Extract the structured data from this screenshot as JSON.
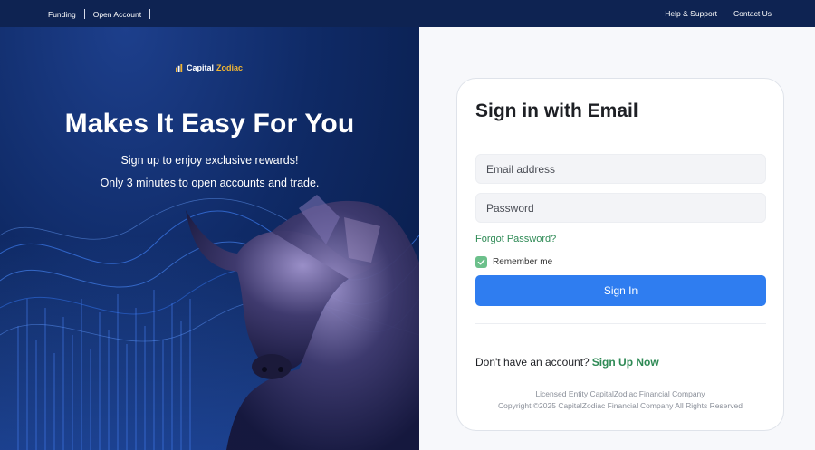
{
  "topbar": {
    "left_links": [
      "Funding",
      "Open Account"
    ],
    "right_links": [
      "Help & Support",
      "Contact Us"
    ]
  },
  "logo": {
    "part1": "Capital",
    "part2": "Zodiac"
  },
  "hero": {
    "title": "Makes It Easy For You",
    "subtitle1": "Sign up to enjoy exclusive rewards!",
    "subtitle2": "Only 3 minutes to open accounts and trade."
  },
  "signin": {
    "title": "Sign in with Email",
    "email_placeholder": "Email address",
    "password_placeholder": "Password",
    "forgot": "Forgot Password?",
    "remember": "Remember me",
    "button": "Sign In",
    "no_account": "Don't have an account?",
    "signup": "Sign Up Now",
    "license1": "Licensed Entity CapitalZodiac Financial Company",
    "license2": "Copyright ©2025 CapitalZodiac Financial Company All Rights Reserved"
  },
  "colors": {
    "primary": "#2f7df0",
    "link": "#2e8a55",
    "accent": "#f2b632",
    "navy": "#0e2352"
  },
  "icons": [
    "logo-mark-icon",
    "checkmark-icon",
    "bull-image"
  ]
}
